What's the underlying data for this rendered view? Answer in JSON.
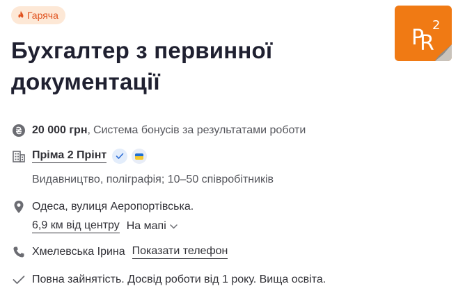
{
  "badge": {
    "label": "Гаряча",
    "color": "#e0521e"
  },
  "logo": {
    "text": "PR",
    "superscript": "2",
    "color": "#f07a14"
  },
  "title": "Бухгалтер з первинної документації",
  "salary": {
    "amount": "20 000 грн",
    "separator": ",",
    "note": "Система бонусів за результатами роботи",
    "icon": "hryvnia-icon"
  },
  "company": {
    "name": "Пріма 2 Прінт",
    "verified_icon": "check-icon",
    "flag_icon": "ukraine-flag-icon",
    "details": "Видавництво, поліграфія; 10–50 співробітників"
  },
  "location": {
    "address": "Одеса, вулиця Аеропортівська.",
    "distance": "6,9 км від центру",
    "map_label": "На мапі",
    "icon": "map-pin-icon"
  },
  "contact": {
    "name": "Хмелевська Ірина",
    "phone_link": "Показати телефон",
    "icon": "phone-icon"
  },
  "requirements": {
    "text": "Повна зайнятість. Досвід роботи від 1 року. Вища освіта.",
    "icon": "checkmark-icon"
  }
}
